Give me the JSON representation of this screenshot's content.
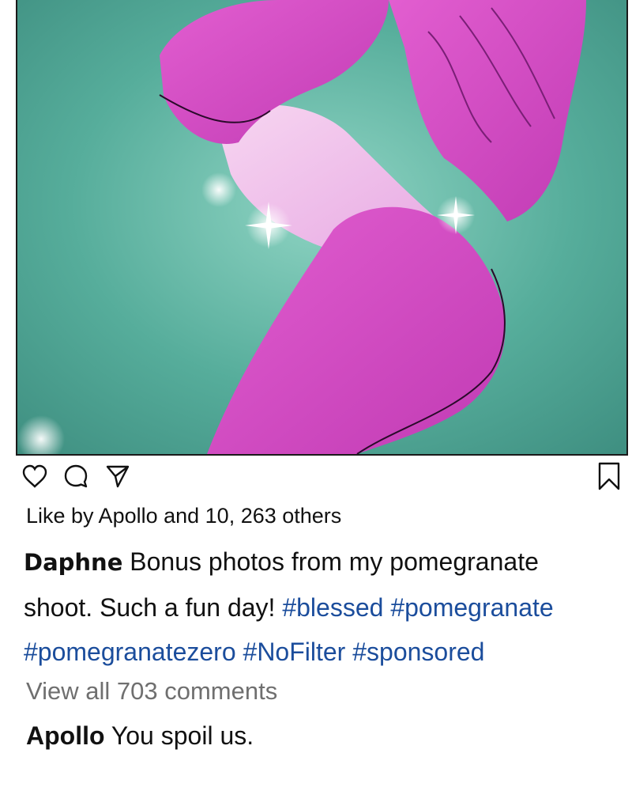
{
  "post": {
    "likes_text": "Like by Apollo and 10, 263 others",
    "caption": {
      "username": "Daphne",
      "text": "Bonus photos from my pomegranate shoot. Such a fun day!",
      "hashtags": [
        "#blessed",
        "#pomegranate",
        "#pomegranatezero",
        "#NoFilter",
        "#sponsored"
      ]
    },
    "view_comments_text": "View all 703 comments",
    "comment": {
      "username": "Apollo",
      "text": "You spoil us."
    }
  },
  "icons": {
    "like": "heart-icon",
    "comment": "speech-bubble-icon",
    "share": "paper-plane-icon",
    "save": "bookmark-icon"
  },
  "colors": {
    "background_teal": "#4fa999",
    "figure_pink": "#d94cc4",
    "hashtag_blue": "#1b4d9c",
    "muted_gray": "#6f6f6f"
  }
}
